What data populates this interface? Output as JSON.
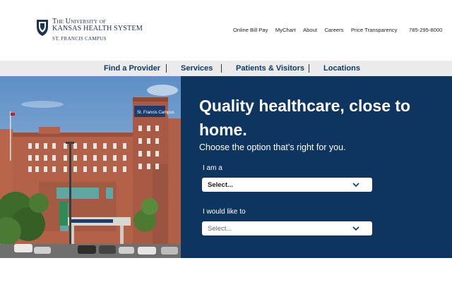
{
  "brand": {
    "line1": "The University of",
    "line2": "Kansas Health System",
    "line3": "St. Francis Campus",
    "navy": "#1d3150",
    "logo_icon": "jayhawk-shield-logo"
  },
  "utility_nav": {
    "items": [
      "Online Bill Pay",
      "MyChart",
      "About",
      "Careers",
      "Price Transparency"
    ],
    "phone": "785-295-8000"
  },
  "main_nav": {
    "items": [
      "Find a Provider",
      "Services",
      "Patients & Visitors",
      "Locations"
    ],
    "background": "#ebebeb",
    "text_color": "#0b3a6b"
  },
  "hero": {
    "headline": "Quality healthcare, close to home.",
    "subtitle": "Choose the option that’s right for you.",
    "panel_color": "#0e3560",
    "image": "hospital-building-photo",
    "building_sign": "St. Francis Campus",
    "fields": [
      {
        "label": "I am a",
        "value": "Select...",
        "icon": "chevron-down-icon"
      },
      {
        "label": "I would like to",
        "value": "Select...",
        "icon": "chevron-down-icon"
      }
    ]
  }
}
